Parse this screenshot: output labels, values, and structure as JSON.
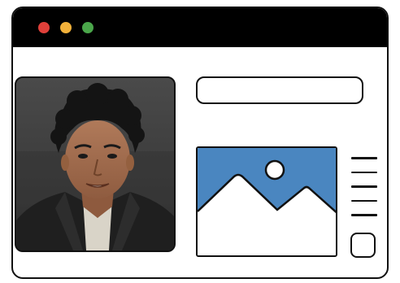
{
  "window": {
    "controls": [
      {
        "name": "close",
        "color": "#e0403a"
      },
      {
        "name": "minimize",
        "color": "#f2b13a"
      },
      {
        "name": "maximize",
        "color": "#4aa64a"
      }
    ]
  },
  "video_tile": {
    "icon": "person-video-feed"
  },
  "text_field": {
    "value": ""
  },
  "image_card": {
    "icon": "landscape-image-icon",
    "accent_color": "#4a86c0"
  },
  "text_lines": {
    "count_icon": "text-lines-icon"
  },
  "square_button": {
    "icon": "rounded-square-button"
  }
}
